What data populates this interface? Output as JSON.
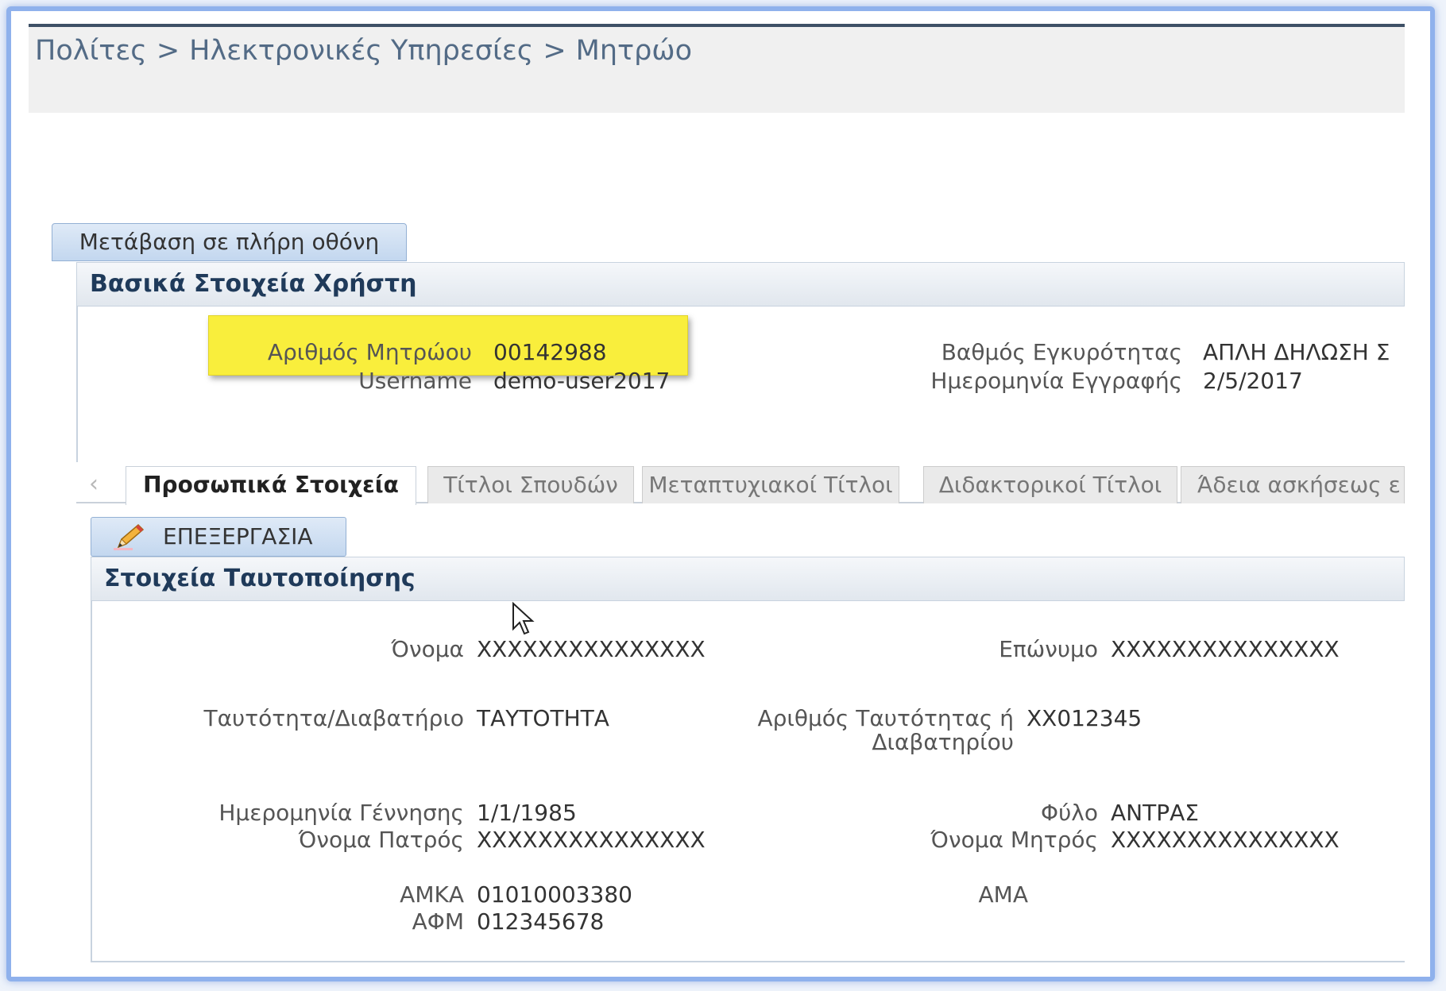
{
  "breadcrumb": {
    "items": [
      "Πολίτες",
      "Ηλεκτρονικές Υπηρεσίες",
      "Μητρώο"
    ],
    "separator": ">"
  },
  "fullscreen_button": "Μετάβαση σε πλήρη οθόνη",
  "basic_info": {
    "title": "Βασικά Στοιχεία Χρήστη",
    "registry_number_label": "Αριθμός Μητρώου",
    "registry_number": "00142988",
    "username_label": "Username",
    "username": "demo-user2017",
    "validity_label": "Βαθμός Εγκυρότητας",
    "validity": "ΑΠΛΗ ΔΗΛΩΣΗ Σ",
    "registration_date_label": "Ημερομηνία Εγγραφής",
    "registration_date": "2/5/2017"
  },
  "tabs": [
    {
      "label": "Προσωπικά Στοιχεία",
      "active": true
    },
    {
      "label": "Τίτλοι Σπουδών",
      "active": false
    },
    {
      "label": "Μεταπτυχιακοί Τίτλοι",
      "active": false
    },
    {
      "label": "Διδακτορικοί Τίτλοι",
      "active": false
    },
    {
      "label": "Άδεια ασκήσεως ε",
      "active": false
    }
  ],
  "tab_scroll_left": "‹",
  "edit_button": "ΕΠΕΞΕΡΓΑΣΙΑ",
  "identity": {
    "title": "Στοιχεία Ταυτοποίησης",
    "first_name_label": "Όνομα",
    "first_name": "XXXXXXXXXXXXXXX",
    "last_name_label": "Επώνυμο",
    "last_name": "XXXXXXXXXXXXXXX",
    "doc_type_label": "Ταυτότητα/Διαβατήριο",
    "doc_type": "ΤΑΥΤΟΤΗΤΑ",
    "doc_number_label_line1": "Αριθμός Ταυτότητας ή",
    "doc_number_label_line2": "Διαβατηρίου",
    "doc_number": "XX012345",
    "birth_date_label": "Ημερομηνία Γέννησης",
    "birth_date": "1/1/1985",
    "gender_label": "Φύλο",
    "gender": "ΑΝΤΡΑΣ",
    "father_name_label": "Όνομα Πατρός",
    "father_name": "XXXXXXXXXXXXXXX",
    "mother_name_label": "Όνομα Μητρός",
    "mother_name": "XXXXXXXXXXXXXXX",
    "amka_label": "ΑΜΚΑ",
    "amka": "01010003380",
    "ama_label": "ΑΜΑ",
    "afm_label": "ΑΦΜ",
    "afm": "012345678"
  },
  "colors": {
    "frame": "#8fb1ec",
    "header_text": "#1f3a5a",
    "highlight": "#f9ee3c",
    "breadcrumb": "#536b86"
  },
  "icons": {
    "edit": "pencil-icon",
    "cursor": "mouse-pointer-icon"
  }
}
